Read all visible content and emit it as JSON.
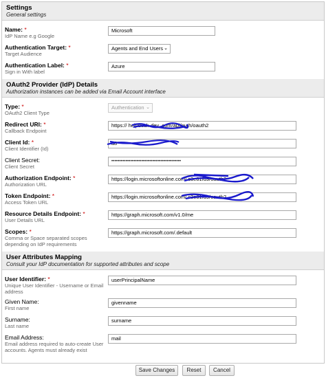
{
  "settings": {
    "title": "Settings",
    "subtitle": "General settings"
  },
  "name": {
    "label": "Name:",
    "hint": "IdP Name e.g Google",
    "value": "Microsoft"
  },
  "auth_target": {
    "label": "Authentication Target:",
    "hint": "Target Audience",
    "value": "Agents and End Users"
  },
  "auth_label": {
    "label": "Authentication Label:",
    "hint": "Sign in With label",
    "value": "Azure"
  },
  "oauth": {
    "title": "OAuth2 Provider (IdP) Details",
    "subtitle": "Authorization instances can be added via Email Account interface"
  },
  "type": {
    "label": "Type:",
    "hint": "OAuth2 Client Type",
    "value": "Authentication"
  },
  "redirect_uri": {
    "label": "Redirect URI:",
    "hint": "Callback Endpoint",
    "value": "https://        helpdesk-dev                .com/api/auth/oauth2"
  },
  "client_id": {
    "label": "Client Id:",
    "hint": "Client Identifier (Id)",
    "value": "                                                   a8"
  },
  "client_secret": {
    "label": "Client Secret:",
    "hint": "Client Secret",
    "value": "••••••••••••••••••••••••••••••••••••••••••••"
  },
  "auth_endpoint": {
    "label": "Authorization Endpoint:",
    "hint": "Authorization URL",
    "value": "https://login.microsoftonline.com/                           c3e81fd9/oauth2"
  },
  "token_endpoint": {
    "label": "Token Endpoint:",
    "hint": "Access Token URL",
    "value": "https://login.microsoftonline.com/                          c3e81fd9/oauth2"
  },
  "resource_endpoint": {
    "label": "Resource Details Endpoint:",
    "hint": "User Details URL",
    "value": "https://graph.microsoft.com/v1.0/me"
  },
  "scopes": {
    "label": "Scopes:",
    "hint": "Comma or Space separated scopes depending on IdP requirements",
    "value": "https://graph.microsoft.com/.default"
  },
  "mapping": {
    "title": "User Attributes Mapping",
    "subtitle": "Consult your IdP documentation for supported attributes and scope"
  },
  "user_identifier": {
    "label": "User Identifier:",
    "hint": "Unique User Identifier - Username or Email address",
    "value": "userPrincipalName"
  },
  "given_name": {
    "label": "Given Name:",
    "hint": "First name",
    "value": "givenname"
  },
  "surname": {
    "label": "Surname:",
    "hint": "Last name",
    "value": "surname"
  },
  "email": {
    "label": "Email Address:",
    "hint": "Email address required to auto-create User accounts. Agents must already exist",
    "value": "mail"
  },
  "required_mark": "*",
  "chevron_glyph": "⌄",
  "buttons": {
    "save": "Save Changes",
    "reset": "Reset",
    "cancel": "Cancel"
  },
  "colors": {
    "section_bg": "#ececec",
    "required": "#cc0000",
    "redaction": "#1a1acc"
  }
}
